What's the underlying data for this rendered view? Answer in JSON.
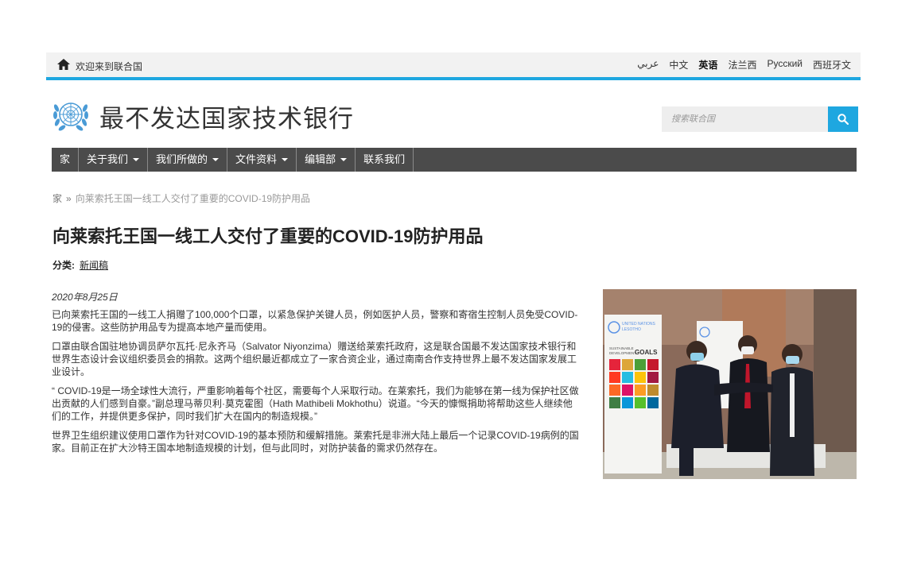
{
  "topbar": {
    "welcome": "欢迎来到联合国",
    "languages": [
      {
        "label": "عربي",
        "active": false
      },
      {
        "label": "中文",
        "active": false
      },
      {
        "label": "英语",
        "active": true
      },
      {
        "label": "法兰西",
        "active": false
      },
      {
        "label": "Русский",
        "active": false
      },
      {
        "label": "西班牙文",
        "active": false
      }
    ]
  },
  "header": {
    "site_title": "最不发达国家技术银行",
    "search_placeholder": "搜索联合国"
  },
  "nav": {
    "items": [
      {
        "label": "家",
        "dropdown": false
      },
      {
        "label": "关于我们",
        "dropdown": true
      },
      {
        "label": "我们所做的",
        "dropdown": true
      },
      {
        "label": "文件资料",
        "dropdown": true
      },
      {
        "label": "编辑部",
        "dropdown": true
      },
      {
        "label": "联系我们",
        "dropdown": false
      }
    ]
  },
  "breadcrumb": {
    "home": "家",
    "separator": "»",
    "current": "向莱索托王国一线工人交付了重要的COVID-19防护用品"
  },
  "article": {
    "title": "向莱索托王国一线工人交付了重要的COVID-19防护用品",
    "category_label": "分类:",
    "category": "新闻稿",
    "date": "2020年8月25日",
    "paragraphs": [
      "已向莱索托王国的一线工人捐赠了100,000个口罩，以紧急保护关键人员，例如医护人员，警察和寄宿生控制人员免受COVID-19的侵害。这些防护用品专为提高本地产量而使用。",
      "口罩由联合国驻地协调员萨尔瓦托·尼永齐马（Salvator Niyonzima）赠送给莱索托政府，这是联合国最不发达国家技术银行和世界生态设计会议组织委员会的捐款。这两个组织最近都成立了一家合资企业，通过南南合作支持世界上最不发达国家发展工业设计。",
      "“ COVID-19是一场全球性大流行，严重影响着每个社区，需要每个人采取行动。在莱索托，我们为能够在第一线为保护社区做出贡献的人们感到自豪。”副总理马蒂贝利·莫克霍图（Hath Mathibeli Mokhothu）说道。“今天的慷慨捐助将帮助这些人继续他们的工作，并提供更多保护，同时我们扩大在国内的制造规模。”",
      "世界卫生组织建议使用口罩作为针对COVID-19的基本预防和缓解措施。莱索托是非洲大陆上最后一个记录COVID-19病例的国家。目前正在扩大沙特王国本地制造规模的计划，但与此同时，对防护装备的需求仍然存在。"
    ]
  },
  "photo": {
    "banner_lines": [
      "UNITED NATIONS",
      "LESOTHO"
    ],
    "sdg_lines": [
      "SUSTAINABLE",
      "DEVELOPMENT",
      "GOALS"
    ]
  },
  "colors": {
    "accent": "#1ea7e0",
    "nav_bg": "#4b4b4b",
    "topbar_bg": "#f2f2f2"
  }
}
